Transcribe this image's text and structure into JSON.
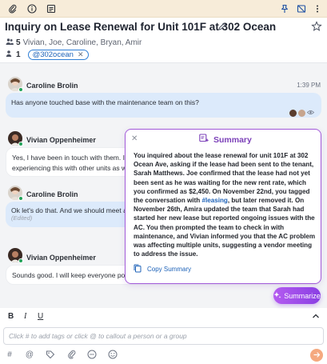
{
  "thread": {
    "title": "Inquiry on Lease Renewal for Unit 101F at 302 Ocean",
    "participants_count": "5",
    "participants": "Vivian, Joe, Caroline, Bryan, Amir",
    "tags_count": "1",
    "tag": "@302ocean"
  },
  "messages": [
    {
      "author": "Caroline Brolin",
      "time": "1:39 PM",
      "text": "Has anyone touched base with the maintenance team on this?"
    },
    {
      "author": "Vivian Oppenheimer",
      "text": "Yes, I have been in touch with them. I le",
      "text2": "experiencing this with other units as we"
    },
    {
      "author": "Caroline Brolin",
      "text": "Ok let's do that. And we should meet afte",
      "edited": "(Edited)"
    },
    {
      "author": "Vivian Oppenheimer",
      "text": "Sounds good.  I will keep everyone post"
    }
  ],
  "summary": {
    "title": "Summary",
    "text_before": "You inquired about the lease renewal for unit 101F at 302 Ocean Ave, asking if the lease had been sent to the tenant, Sarah Matthews. Joe confirmed that the lease had not yet been sent as he was waiting for the new rent rate, which you confirmed as $2,450. On November 22nd, you tagged the conversation with ",
    "hashtag": "#leasing",
    "text_after": ", but later removed it. On November 26th, Amira updated the team that Sarah had started her new lease but reported ongoing issues with the AC. You then prompted the team to check in with maintenance, and Vivian informed you that the AC problem was affecting multiple units, suggesting a vendor meeting to address the issue.",
    "copy_label": "Copy Summary"
  },
  "summarize_button": "Summarize",
  "composer": {
    "bold": "B",
    "italic": "I",
    "underline": "U",
    "placeholder": "Click # to add tags or click @ to callout a person or a group"
  },
  "colors": {
    "toolbar_bg": "#f7ecd9",
    "accent_purple": "#8a3fe3",
    "link_blue": "#1d62b8",
    "bubble_blue": "#dceafb",
    "send_orange": "#f5a97f"
  },
  "icons": [
    "paperclip-icon",
    "info-icon",
    "archive-icon",
    "pin-icon",
    "mute-icon",
    "more-icon",
    "pencil-icon",
    "star-icon",
    "users-icon",
    "user-icon",
    "close-icon",
    "sparkle-icon",
    "copy-icon",
    "chevron-up-icon",
    "hash-icon",
    "at-icon",
    "tag-icon",
    "attach-icon",
    "gif-icon",
    "emoji-icon",
    "send-icon"
  ]
}
